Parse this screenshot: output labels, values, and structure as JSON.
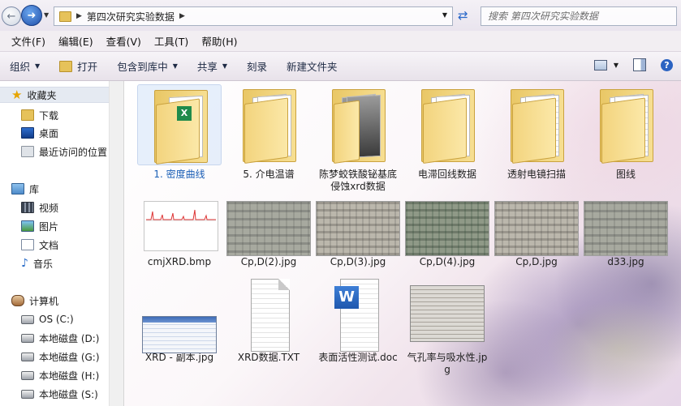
{
  "address": {
    "breadcrumb": "第四次研究实验数据",
    "search_placeholder": "搜索 第四次研究实验数据"
  },
  "menu": [
    "文件(F)",
    "编辑(E)",
    "查看(V)",
    "工具(T)",
    "帮助(H)"
  ],
  "toolbar": {
    "organize": "组织",
    "open": "打开",
    "include_library": "包含到库中",
    "share": "共享",
    "burn": "刻录",
    "new_folder": "新建文件夹"
  },
  "sidebar": {
    "favorites": "收藏夹",
    "downloads": "下载",
    "desktop": "桌面",
    "recent": "最近访问的位置",
    "libraries": "库",
    "videos": "视频",
    "pictures": "图片",
    "documents": "文档",
    "music": "音乐",
    "computer": "计算机",
    "drive_c": "OS (C:)",
    "drive_d": "本地磁盘 (D:)",
    "drive_g": "本地磁盘 (G:)",
    "drive_h": "本地磁盘 (H:)",
    "drive_s": "本地磁盘 (S:)"
  },
  "files": [
    {
      "name": "1. 密度曲线",
      "kind": "folder-excel-icon"
    },
    {
      "name": "5. 介电温谱",
      "kind": "folder-icon"
    },
    {
      "name": "陈梦蛟铁酸铋基底侵蚀xrd数据",
      "kind": "folder-icon"
    },
    {
      "name": "电滞回线数据",
      "kind": "folder-icon"
    },
    {
      "name": "透射电镜扫描",
      "kind": "folder-icon"
    },
    {
      "name": "图线",
      "kind": "folder-icon"
    },
    {
      "name": "cmjXRD.bmp",
      "kind": "bmp-thumbnail"
    },
    {
      "name": "Cp,D(2).jpg",
      "kind": "photo-thumbnail"
    },
    {
      "name": "Cp,D(3).jpg",
      "kind": "photo-thumbnail"
    },
    {
      "name": "Cp,D(4).jpg",
      "kind": "photo-thumbnail"
    },
    {
      "name": "Cp,D.jpg",
      "kind": "photo-thumbnail"
    },
    {
      "name": "d33.jpg",
      "kind": "photo-thumbnail"
    },
    {
      "name": "XRD - 副本.jpg",
      "kind": "screenshot-thumbnail"
    },
    {
      "name": "XRD数据.TXT",
      "kind": "text-file-icon"
    },
    {
      "name": "表面活性测试.doc",
      "kind": "word-doc-icon"
    },
    {
      "name": "气孔率与吸水性.jpg",
      "kind": "scan-thumbnail"
    }
  ],
  "colors": {
    "selection": "#dce8fa",
    "selected_label": "#1b5fb6",
    "folder": "#e9c766"
  }
}
